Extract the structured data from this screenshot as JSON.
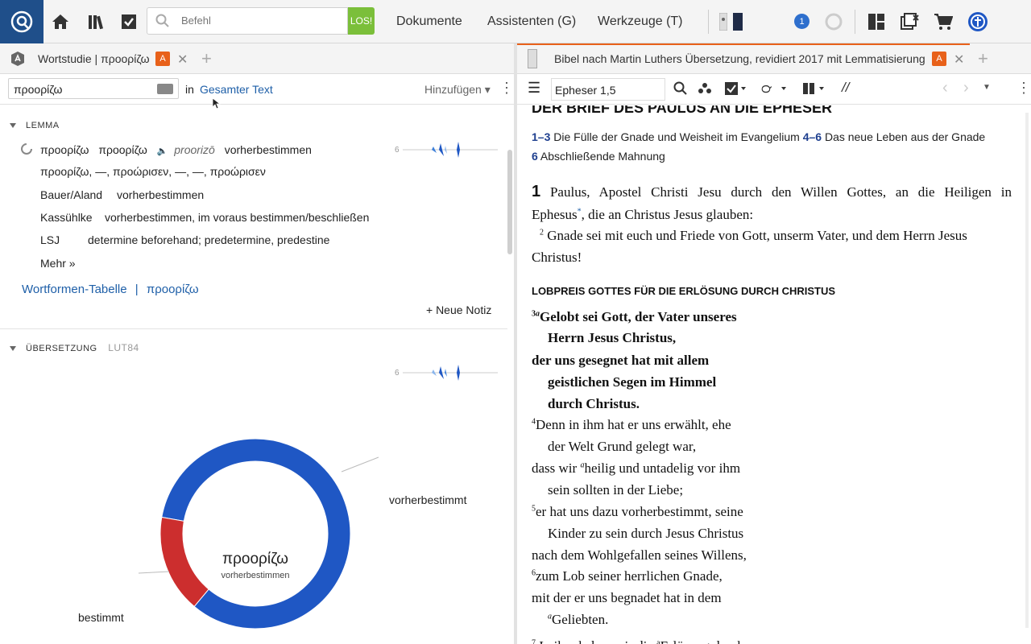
{
  "topbar": {
    "command_placeholder": "Befehl",
    "go_label": "LOS!",
    "menu_documents": "Dokumente",
    "menu_assistants": "Assistenten (G)",
    "menu_tools": "Werkzeuge (T)",
    "notification_count": "1"
  },
  "left": {
    "tab_title": "Wortstudie | προορίζω",
    "tab_badge": "A",
    "search_value": "προορίζω",
    "in_label": "in",
    "scope_label": "Gesamter Text",
    "add_label": "Hinzufügen",
    "lemma_header": "LEMMA",
    "lemma_word": "προορίζω",
    "lemma_word2": "προορίζω",
    "lemma_translit": "proorizō",
    "lemma_gloss": "vorherbestimmen",
    "lemma_forms": "προορίζω, —, προώρισεν, —, —, προώρισεν",
    "lemma_count": "6",
    "dict": [
      {
        "name": "Bauer/Aland",
        "gloss": "vorherbestimmen"
      },
      {
        "name": "Kassühlke",
        "gloss": "vorherbestimmen, im voraus bestimmen/beschließen"
      },
      {
        "name": "LSJ",
        "gloss": "determine beforehand; predetermine, predestine"
      }
    ],
    "more_label": "Mehr »",
    "wordforms_label": "Wortformen-Tabelle",
    "wordforms_word": "προορίζω",
    "new_note_label": "+ Neue Notiz",
    "translation_header": "ÜBERSETZUNG",
    "translation_version": "LUT84",
    "translation_count": "6",
    "donut_center_word": "προορίζω",
    "donut_center_gloss": "vorherbestimmen",
    "donut_label_main": "vorherbestimmt",
    "donut_label_minor": "bestimmt"
  },
  "chart_data": {
    "type": "pie",
    "categories": [
      "vorherbestimmt",
      "bestimmt"
    ],
    "values": [
      5,
      1
    ],
    "colors": [
      "#1f57c4",
      "#cc2e2e"
    ]
  },
  "right": {
    "tab_title": "Bibel nach Martin Luthers Übersetzung, revidiert 2017 mit Lemmatisierung",
    "tab_badge": "A",
    "reference": "Epheser 1,5",
    "book_title": "DER BRIEF DES PAULUS AN DIE EPHESER",
    "outline": {
      "r1": "1–3",
      "t1": "Die Fülle der Gnade und Weisheit im Evangelium",
      "r2": "4–6",
      "t2": "Das neue Leben aus der Gnade",
      "r3": "6",
      "t3": "Abschließende Mahnung"
    },
    "ch_num": "1",
    "v1a": "Paulus, Apostel Christi Jesu durch den Willen Gottes, an die Heiligen in",
    "v1b": "Ephesus",
    "v1c": ", die an Christus Jesus glauben:",
    "v2n": "2",
    "v2a": "Gnade sei mit euch und Friede von Gott, unserm Vater, und dem Herrn Jesus",
    "v2b": "Christus!",
    "section_heading": "LOBPREIS GOTTES FÜR DIE ERLÖSUNG DURCH CHRISTUS",
    "lines": [
      {
        "n": "3",
        "sup": "a",
        "t": "Gelobt sei Gott, der Vater unseres",
        "bold": true,
        "indent": false
      },
      {
        "n": "",
        "sup": "",
        "t": "Herrn Jesus Christus,",
        "bold": true,
        "indent": true
      },
      {
        "n": "",
        "sup": "",
        "t": "der uns gesegnet hat mit allem",
        "bold": true,
        "indent": false
      },
      {
        "n": "",
        "sup": "",
        "t": "geistlichen Segen im Himmel",
        "bold": true,
        "indent": true
      },
      {
        "n": "",
        "sup": "",
        "t": "durch Christus.",
        "bold": true,
        "indent": true
      },
      {
        "n": "4",
        "sup": "",
        "t": "Denn in ihm hat er uns erwählt, ehe",
        "bold": false,
        "indent": false
      },
      {
        "n": "",
        "sup": "",
        "t": "der Welt Grund gelegt war,",
        "bold": false,
        "indent": true
      },
      {
        "n": "",
        "sup": "",
        "t": "dass wir ",
        "sup2": "a",
        "t2": "heilig und untadelig vor ihm",
        "bold": false,
        "indent": false
      },
      {
        "n": "",
        "sup": "",
        "t": "sein sollten in der Liebe;",
        "bold": false,
        "indent": true
      },
      {
        "n": "5",
        "sup": "",
        "t": "er hat uns dazu vorherbestimmt, seine",
        "bold": false,
        "indent": false
      },
      {
        "n": "",
        "sup": "",
        "t": "Kinder zu sein durch Jesus Christus",
        "bold": false,
        "indent": true
      },
      {
        "n": "",
        "sup": "",
        "t": "nach dem Wohlgefallen seines Willens,",
        "bold": false,
        "indent": false
      },
      {
        "n": "6",
        "sup": "",
        "t": "zum Lob seiner herrlichen Gnade,",
        "bold": false,
        "indent": false
      },
      {
        "n": "",
        "sup": "",
        "t": "mit der er uns begnadet hat in dem",
        "bold": false,
        "indent": false
      },
      {
        "n": "",
        "sup": "a",
        "t": "Geliebten.",
        "bold": false,
        "indent": true
      }
    ]
  }
}
